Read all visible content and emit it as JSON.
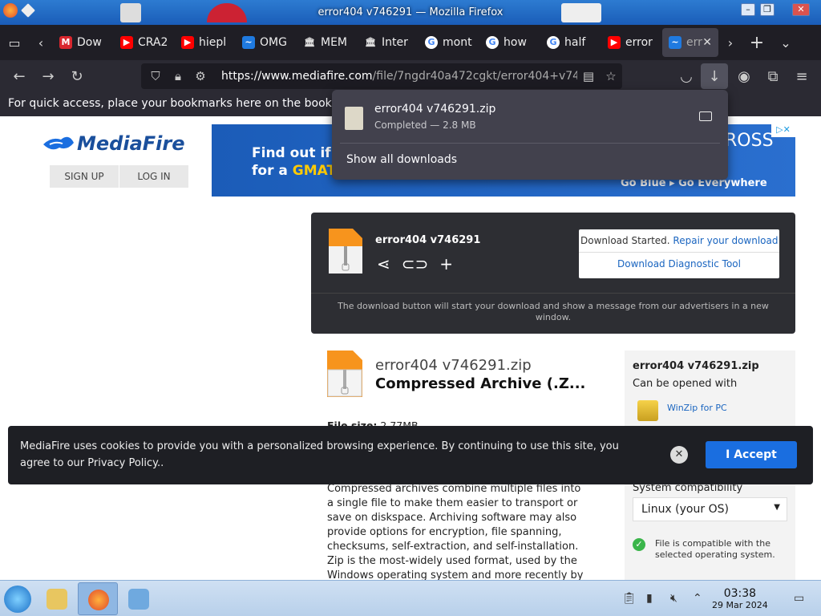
{
  "window": {
    "title": "error404 v746291 — Mozilla Firefox"
  },
  "tabs": [
    {
      "label": "Dow",
      "favicon": "mega-icon",
      "color": "#d9272e"
    },
    {
      "label": "CRA2",
      "favicon": "youtube-icon",
      "color": "#ff0000"
    },
    {
      "label": "hiepl",
      "favicon": "youtube-icon",
      "color": "#ff0000"
    },
    {
      "label": "OMG",
      "favicon": "mediafire-icon",
      "color": "#1f7ae0"
    },
    {
      "label": "MEM",
      "favicon": "museum-icon",
      "color": "#dddddd"
    },
    {
      "label": "Inter",
      "favicon": "museum-icon",
      "color": "#dddddd"
    },
    {
      "label": "mont",
      "favicon": "google-icon",
      "color": "#ffffff"
    },
    {
      "label": "how",
      "favicon": "google-icon",
      "color": "#ffffff"
    },
    {
      "label": "half",
      "favicon": "google-icon",
      "color": "#ffffff"
    },
    {
      "label": "error",
      "favicon": "youtube-icon",
      "color": "#ff0000"
    },
    {
      "label": "err",
      "favicon": "mediafire-icon",
      "color": "#1f7ae0",
      "active": true
    }
  ],
  "navbar": {
    "url_domain": "https://www.mediafire.com",
    "url_rest": "/file/7ngdr40a472cgkt/error404+v74"
  },
  "bookmarks_hint": "For quick access, place your bookmarks here on the bookmarks toolbar.",
  "downloads_panel": {
    "file_name": "error404 v746291.zip",
    "status": "Completed — 2.8 MB",
    "show_all": "Show all downloads"
  },
  "page": {
    "logo": "MediaFire",
    "sign_up": "SIGN UP",
    "log_in": "LOG IN",
    "ad": {
      "line1": "Find out if y",
      "line2_prefix": "for a ",
      "line2_highlight": "GMAT/G",
      "brand_tail": "ROSS",
      "tagline": "Go Blue  ▸ Go Everywhere"
    },
    "download_box": {
      "file_name": "error404 v746291",
      "status_text": "Download Started.",
      "repair_link": "Repair your download",
      "diagnostic_link": "Download Diagnostic Tool",
      "note": "The download button will start your download and show a message from our advertisers in a new window."
    },
    "file_info": {
      "name": "error404 v746291.zip",
      "type": "Compressed Archive (.Z...",
      "size_label": "File size:",
      "size_value": "2.77MB",
      "description": "Compressed archives combine multiple files into a single file to make them easier to transport or save on diskspace. Archiving software may also provide options for encryption, file spanning, checksums, self-extraction, and self-installation. Zip is the most-widely used format, used by the Windows operating system and more recently by"
    },
    "sidebar": {
      "file_name": "error404 v746291.zip",
      "opened_with": "Can be opened with",
      "app": "WinZip for PC",
      "compat_label": "System compatibility",
      "os_selected": "Linux (your OS)",
      "compat_note": "File is compatible with the selected operating system."
    },
    "cookie": {
      "text": "MediaFire uses cookies to provide you with a personalized browsing experience. By continuing to use this site, you agree to our Privacy Policy..",
      "accept": "I Accept"
    }
  },
  "taskbar": {
    "time": "03:38",
    "date": "29 Mar 2024"
  }
}
